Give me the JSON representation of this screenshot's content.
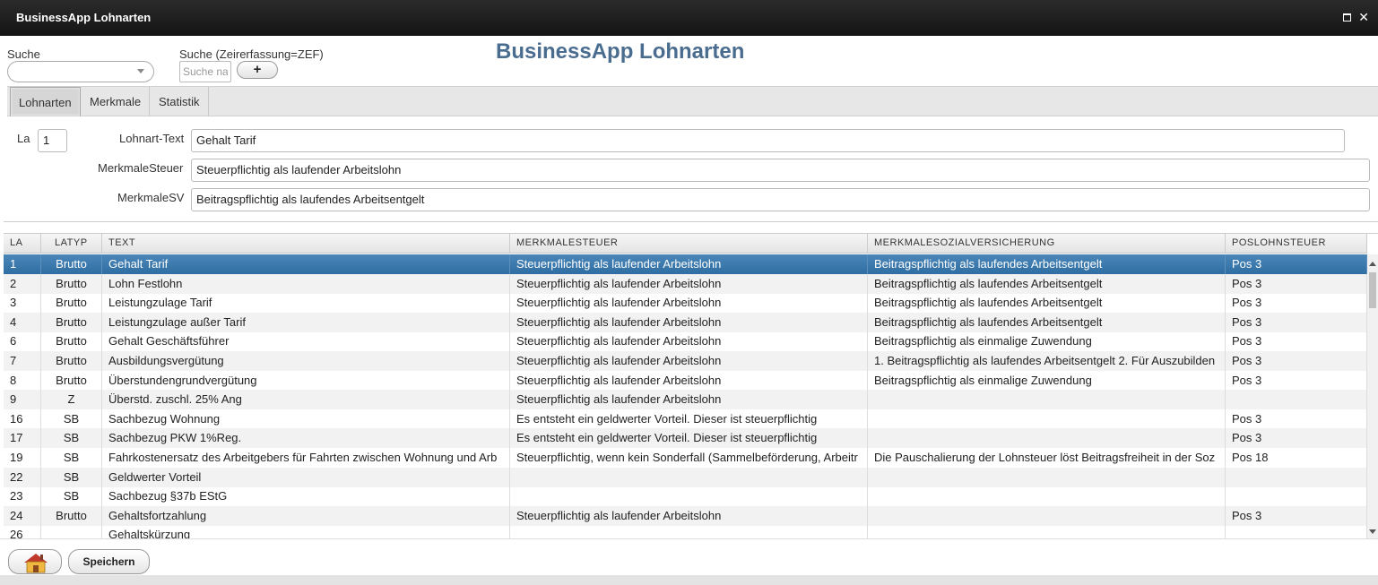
{
  "window": {
    "title": "BusinessApp Lohnarten"
  },
  "search": {
    "label": "Suche",
    "zef_label": "Suche (Zeirerfassung=ZEF)",
    "zef_placeholder": "Suche na",
    "add_label": "+"
  },
  "page_title": "BusinessApp Lohnarten",
  "tabs": [
    {
      "label": "Lohnarten"
    },
    {
      "label": "Merkmale"
    },
    {
      "label": "Statistik"
    }
  ],
  "form": {
    "la_label": "La",
    "la_value": "1",
    "text_label": "Lohnart-Text",
    "text_value": "Gehalt Tarif",
    "steuer_label": "MerkmaleSteuer",
    "steuer_value": "Steuerpflichtig als laufender Arbeitslohn",
    "sv_label": "MerkmaleSV",
    "sv_value": "Beitragspflichtig als laufendes Arbeitsentgelt"
  },
  "table": {
    "columns": [
      "LA",
      "LATYP",
      "TEXT",
      "MERKMALESTEUER",
      "MERKMALESOZIALVERSICHERUNG",
      "POSLOHNSTEUER"
    ],
    "rows": [
      [
        "1",
        "Brutto",
        "Gehalt Tarif",
        "Steuerpflichtig als laufender Arbeitslohn",
        "Beitragspflichtig als laufendes Arbeitsentgelt",
        "Pos 3"
      ],
      [
        "2",
        "Brutto",
        "Lohn Festlohn",
        "Steuerpflichtig als laufender Arbeitslohn",
        "Beitragspflichtig als laufendes Arbeitsentgelt",
        "Pos 3"
      ],
      [
        "3",
        "Brutto",
        "Leistungzulage Tarif",
        "Steuerpflichtig als laufender Arbeitslohn",
        "Beitragspflichtig als laufendes Arbeitsentgelt",
        "Pos 3"
      ],
      [
        "4",
        "Brutto",
        "Leistungzulage außer Tarif",
        "Steuerpflichtig als laufender Arbeitslohn",
        "Beitragspflichtig als laufendes Arbeitsentgelt",
        "Pos 3"
      ],
      [
        "6",
        "Brutto",
        "Gehalt Geschäftsführer",
        "Steuerpflichtig als laufender Arbeitslohn",
        "Beitragspflichtig als einmalige Zuwendung",
        "Pos 3"
      ],
      [
        "7",
        "Brutto",
        "Ausbildungsvergütung",
        "Steuerpflichtig als laufender Arbeitslohn",
        "1. Beitragspflichtig als laufendes Arbeitsentgelt 2. Für Auszubilden",
        "Pos 3"
      ],
      [
        "8",
        "Brutto",
        "Überstundengrundvergütung",
        "Steuerpflichtig als laufender Arbeitslohn",
        "Beitragspflichtig als einmalige Zuwendung",
        "Pos 3"
      ],
      [
        "9",
        "Z",
        "Überstd. zuschl. 25% Ang",
        "Steuerpflichtig als laufender Arbeitslohn",
        "",
        ""
      ],
      [
        "16",
        "SB",
        "Sachbezug Wohnung",
        "Es entsteht ein geldwerter Vorteil. Dieser ist steuerpflichtig",
        "",
        "Pos 3"
      ],
      [
        "17",
        "SB",
        "Sachbezug PKW 1%Reg.",
        "Es entsteht ein geldwerter Vorteil. Dieser ist steuerpflichtig",
        "",
        "Pos 3"
      ],
      [
        "19",
        "SB",
        "Fahrkostenersatz des Arbeitgebers für Fahrten zwischen Wohnung und Arb",
        "Steuerpflichtig, wenn kein Sonderfall (Sammelbeförderung, Arbeitr",
        "Die Pauschalierung der Lohnsteuer löst Beitragsfreiheit in der Soz",
        "Pos 18"
      ],
      [
        "22",
        "SB",
        "Geldwerter Vorteil",
        "",
        "",
        ""
      ],
      [
        "23",
        "SB",
        "Sachbezug §37b EStG",
        "",
        "",
        ""
      ],
      [
        "24",
        "Brutto",
        "Gehaltsfortzahlung",
        "Steuerpflichtig als laufender Arbeitslohn",
        "",
        "Pos 3"
      ],
      [
        "26",
        "",
        "Gehaltskürzung",
        "",
        "",
        ""
      ]
    ]
  },
  "footer": {
    "home_icon": "house-icon",
    "save_label": "Speichern"
  },
  "colors": {
    "title_bar": "#1c1c1c",
    "page_title": "#4a6d8f",
    "selected_row": "#3a78ad"
  }
}
